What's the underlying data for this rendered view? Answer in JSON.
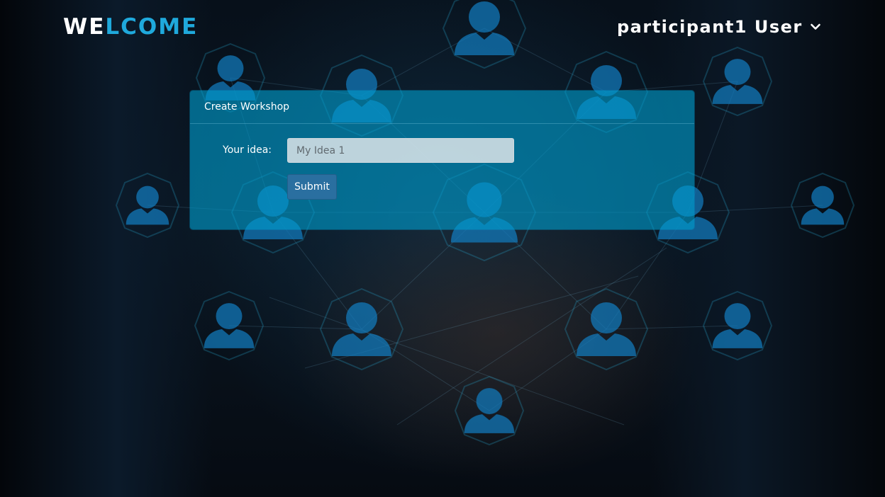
{
  "header": {
    "brand_part1": "WE",
    "brand_part2": "LCOME",
    "user_name": "participant1 User",
    "user_menu_icon": "chevron-down-icon"
  },
  "workshop_form": {
    "title": "Create Workshop",
    "idea_label": "Your idea:",
    "idea_value": "",
    "idea_placeholder": "My Idea 1",
    "submit_label": "Submit"
  },
  "colors": {
    "brand_accent": "#1fa9dc",
    "panel": "#009ccd",
    "submit_button": "#2a6fa0"
  },
  "background": {
    "description_icons": "person-network-icons"
  }
}
